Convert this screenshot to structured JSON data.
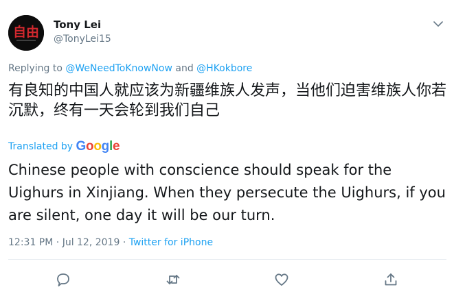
{
  "tweet": {
    "user": {
      "name": "Tony Lei",
      "handle": "@TonyLei15",
      "avatar_text": "自由"
    },
    "reply": {
      "prefix": "Replying to",
      "mention1": "@WeNeedToKnowNow",
      "conjunction": "and",
      "mention2": "@HKokbore"
    },
    "original_text": "有良知的中国人就应该为新疆维族人发声，当他们迫害维族人你若沉默，终有一天会轮到我们自己",
    "translation": {
      "label": "Translated by",
      "provider": [
        "G",
        "o",
        "o",
        "g",
        "l",
        "e"
      ],
      "text": "Chinese people with conscience should speak for the Uighurs in Xinjiang. When they persecute the Uighurs, if you are silent, one day it will be our turn."
    },
    "meta": {
      "time": "12:31 PM",
      "separator": "·",
      "date": "Jul 12, 2019",
      "source": "Twitter for iPhone"
    },
    "actions": [
      "reply-icon",
      "retweet-icon",
      "like-icon",
      "share-icon"
    ],
    "colors": {
      "accent": "#1da1f2",
      "secondary_text": "#657786",
      "primary_text": "#14171a",
      "avatar_text": "#d0282e"
    }
  }
}
